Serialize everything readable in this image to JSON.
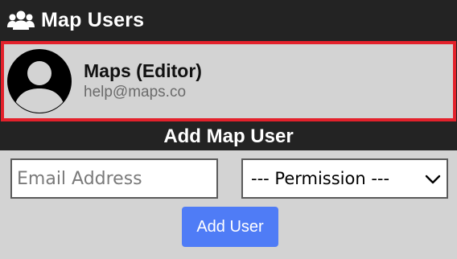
{
  "header": {
    "title": "Map Users",
    "icon": "users-icon"
  },
  "users": [
    {
      "name": "Maps (Editor)",
      "email": "help@maps.co",
      "avatar": "default-avatar-icon",
      "selected": true
    }
  ],
  "add_section": {
    "title": "Add Map User",
    "email_placeholder": "Email Address",
    "email_value": "",
    "permission_selected": "--- Permission ---",
    "add_button_label": "Add User"
  },
  "colors": {
    "header_bg": "#232323",
    "panel_bg": "#d3d3d3",
    "selected_border": "#e3212b",
    "button_bg": "#4f7cf6"
  }
}
